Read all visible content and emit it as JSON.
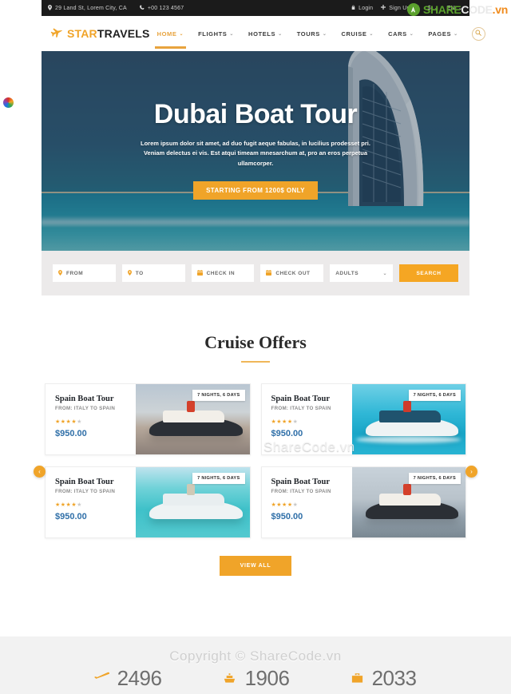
{
  "topbar": {
    "address": "29 Land St, Lorem City, CA",
    "phone": "+00 123 4567",
    "login": "Login",
    "signup": "Sign Up",
    "separator": "|",
    "currency": "$",
    "language": "EN",
    "icons": {
      "location": "location-pin-icon",
      "phone": "phone-icon",
      "lock": "lock-icon",
      "plus": "plus-icon"
    }
  },
  "header": {
    "logo_first": "STAR",
    "logo_second": "TRAVELS",
    "logo_icon": "airplane-icon",
    "nav": [
      {
        "label": "HOME",
        "active": true
      },
      {
        "label": "FLIGHTS",
        "active": false
      },
      {
        "label": "HOTELS",
        "active": false
      },
      {
        "label": "TOURS",
        "active": false
      },
      {
        "label": "CRUISE",
        "active": false
      },
      {
        "label": "CARS",
        "active": false
      },
      {
        "label": "PAGES",
        "active": false
      }
    ],
    "search_icon": "search-icon",
    "caret": "⌄"
  },
  "hero": {
    "title": "Dubai Boat Tour",
    "subtitle": "Lorem ipsum dolor sit amet, ad duo fugit aeque fabulas, in lucilius prodesset pri. Veniam delectus ei vis. Est atqui timeam mnesarchum at, pro an eros perpetua ullamcorper.",
    "cta": "STARTING FROM 1200$ ONLY"
  },
  "searchform": {
    "from": "FROM",
    "to": "TO",
    "checkin": "CHECK IN",
    "checkout": "CHECK OUT",
    "adults": "ADULTS",
    "submit": "SEARCH",
    "caret": "⌄"
  },
  "offers": {
    "title": "Cruise Offers",
    "view_all": "VIEW ALL",
    "prev_icon": "chevron-left-icon",
    "next_icon": "chevron-right-icon",
    "prev_glyph": "‹",
    "next_glyph": "›",
    "cards": [
      {
        "title": "Spain Boat Tour",
        "route": "FROM: ITALY TO SPAIN",
        "stars_on": "★★★★",
        "stars_off": "★",
        "price": "$950.00",
        "badge": "7 NIGHTS, 6 DAYS",
        "photo": "ph-sunset"
      },
      {
        "title": "Spain Boat Tour",
        "route": "FROM: ITALY TO SPAIN",
        "stars_on": "★★★★",
        "stars_off": "★",
        "price": "$950.00",
        "badge": "7 NIGHTS, 6 DAYS",
        "photo": "ph-tropic"
      },
      {
        "title": "Spain Boat Tour",
        "route": "FROM: ITALY TO SPAIN",
        "stars_on": "★★★★",
        "stars_off": "★",
        "price": "$950.00",
        "badge": "7 NIGHTS, 6 DAYS",
        "photo": "ph-lagoon"
      },
      {
        "title": "Spain Boat Tour",
        "route": "FROM: ITALY TO SPAIN",
        "stars_on": "★★★★",
        "stars_off": "★",
        "price": "$950.00",
        "badge": "7 NIGHTS, 6 DAYS",
        "photo": "ph-calm"
      }
    ]
  },
  "stats": [
    {
      "value": "2496",
      "icon": "airplane-icon",
      "glyph": "✈"
    },
    {
      "value": "1906",
      "icon": "ship-icon",
      "glyph": "⛴"
    },
    {
      "value": "2033",
      "icon": "suitcase-icon",
      "glyph": "🧳"
    }
  ],
  "watermark": {
    "copyright": "Copyright © ShareCode.vn",
    "card_overlay": "ShareCode.vn",
    "logo_share": "SHARE",
    "logo_code": "CODE",
    "logo_tld": ".vn"
  },
  "colors": {
    "accent": "#f0a429",
    "price": "#2f6fa8",
    "topbar_bg": "#1b1b1b",
    "hero_bg": "#2d4e63",
    "brand_green": "#5aa02c"
  }
}
